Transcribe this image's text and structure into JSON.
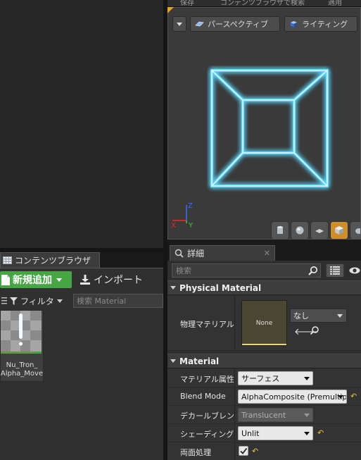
{
  "viewport": {
    "top_strip": [
      "保存",
      "コンテンツブラウザで検索",
      "適用"
    ],
    "perspective_label": "パースペクティブ",
    "lighting_label": "ライティング",
    "axis": {
      "z_label": "Z",
      "x_label": "X",
      "y_label": "Y"
    },
    "toolbar_icons": [
      "cylinder-icon",
      "sphere-icon",
      "plane-icon",
      "cube-icon",
      "teapot-icon"
    ],
    "active_tool": "cube-icon",
    "glow_color": "#5fd8ff"
  },
  "content_browser": {
    "tab_label": "コンテンツブラウザ",
    "add_new_label": "新規追加",
    "import_label": "インポート",
    "filter_label": "フィルタ",
    "search_placeholder": "検索 Material",
    "asset": {
      "name_line1": "Nu_Tron_",
      "name_line2": "Alpha_Move"
    },
    "accent": "#47a644"
  },
  "details": {
    "tab_label": "詳細",
    "search_placeholder": "検索",
    "sections": {
      "physical_material": {
        "header": "Physical Material",
        "prop_label": "物理マテリアル",
        "thumb_text": "None",
        "combo_value": "なし"
      },
      "material": {
        "header": "Material",
        "rows": {
          "domain": {
            "label": "マテリアル属性",
            "value": "サーフェス"
          },
          "blend": {
            "label": "Blend Mode",
            "value": "AlphaComposite (Premultipl"
          },
          "decal": {
            "label": "デカールブレンド",
            "value": "Translucent"
          },
          "shading": {
            "label": "シェーディング",
            "value": "Unlit"
          },
          "two_sided": {
            "label": "両面処理",
            "checked": true
          }
        }
      }
    },
    "reset_color": "#e8c23a"
  }
}
